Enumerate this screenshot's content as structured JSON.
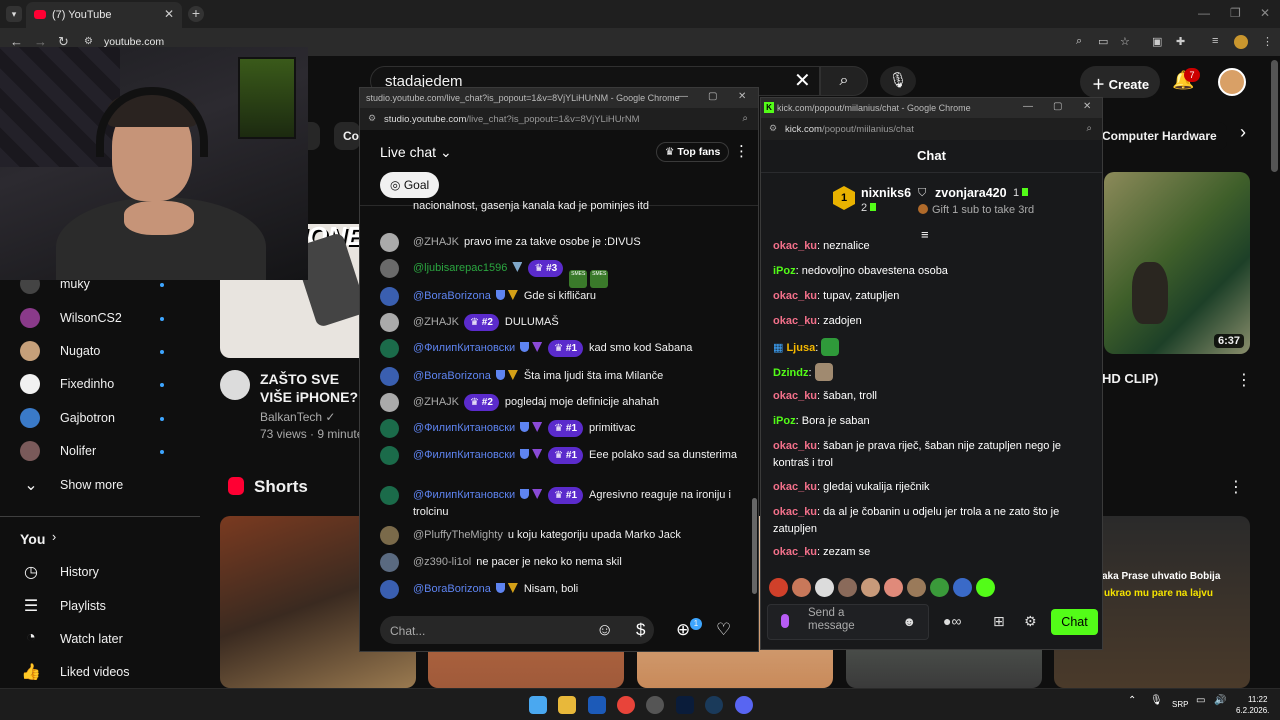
{
  "browser": {
    "tab_title": "(7) YouTube",
    "url": "youtube.com"
  },
  "youtube": {
    "search_query": "stadajedem",
    "create_label": "Create",
    "notif_count": "7",
    "chips": [
      "g",
      "Co",
      "Computer Hardware"
    ],
    "sidebar": [
      {
        "label": "muky",
        "color": "#444444"
      },
      {
        "label": "WilsonCS2",
        "color": "#8a3a8a"
      },
      {
        "label": "Nugato",
        "color": "#c6a07a"
      },
      {
        "label": "Fixedinho",
        "color": "#f1f1f1"
      },
      {
        "label": "Gajbotron",
        "color": "#3a7ac8"
      },
      {
        "label": "Nolifer",
        "color": "#7a5a5a"
      }
    ],
    "show_more": "Show more",
    "you_label": "You",
    "you_items": [
      "History",
      "Playlists",
      "Watch later",
      "Liked videos"
    ],
    "video": {
      "title": "ZAŠTO SVE VIŠE iPHONE?",
      "thumb_text": "ID TE E LIC IONE",
      "channel": "BalkanTech",
      "meta": "73 views · 9 minute"
    },
    "right_video": {
      "title_fragment": "HD CLIP)",
      "duration": "6:37"
    },
    "shorts_label": "Shorts",
    "short_caption_1": "aka Prase uhvatio Bobija",
    "short_caption_2": "ukrao mu pare na lajvu"
  },
  "yt_chat": {
    "window_title": "studio.youtube.com/live_chat?is_popout=1&v=8VjYLiHUrNM - Google Chrome",
    "url_host": "studio.youtube.com",
    "url_path": "/live_chat?is_popout=1&v=8VjYLiHUrNM",
    "header": "Live chat",
    "top_fans": "Top fans",
    "goal": "Goal",
    "input_placeholder": "Chat...",
    "plus_badge": "1",
    "messages": [
      {
        "name": "",
        "text": "nacionalnost, gasenja kanala kad je pominjes itd",
        "cls": "",
        "rank": "",
        "shield": false,
        "v": "",
        "av": "#4a4a4a"
      },
      {
        "name": "@ZHAJK",
        "text": "pravo ime za takve osobe je :DIVUS",
        "cls": "",
        "rank": "",
        "shield": false,
        "v": "",
        "av": "#aaaaaa"
      },
      {
        "name": "@ljubisarepac1596",
        "text": "",
        "cls": "green",
        "rank": "#3",
        "shield": false,
        "v": "#7fa7c8",
        "av": "#6a6a6a",
        "emotes": true
      },
      {
        "name": "@BoraBorizona",
        "text": "Gde si kifličaru",
        "cls": "mem",
        "rank": "",
        "shield": true,
        "v": "#d4a017",
        "av": "#3a5fb0"
      },
      {
        "name": "@ZHAJK",
        "text": "DULUMAŠ",
        "cls": "",
        "rank": "#2",
        "shield": false,
        "v": "",
        "av": "#aaaaaa"
      },
      {
        "name": "@ФилипКитановски",
        "text": "kad smo kod Sabana",
        "cls": "mem",
        "rank": "#1",
        "shield": true,
        "v": "#8a4ad6",
        "av": "#1b6b4a"
      },
      {
        "name": "@BoraBorizona",
        "text": "Šta ima ljudi šta ima Milanče",
        "cls": "mem",
        "rank": "",
        "shield": true,
        "v": "#d4a017",
        "av": "#3a5fb0"
      },
      {
        "name": "@ZHAJK",
        "text": "pogledaj moje definicije ahahah",
        "cls": "",
        "rank": "#2",
        "shield": false,
        "v": "",
        "av": "#aaaaaa"
      },
      {
        "name": "@ФилипКитановски",
        "text": "primitivac",
        "cls": "mem",
        "rank": "#1",
        "shield": true,
        "v": "#8a4ad6",
        "av": "#1b6b4a"
      },
      {
        "name": "@ФилипКитановски",
        "text": "Eee polako sad sa dunsterima",
        "cls": "mem",
        "rank": "#1",
        "shield": true,
        "v": "#8a4ad6",
        "av": "#1b6b4a"
      },
      {
        "name": "@ФилипКитановски",
        "text": "Agresivno reaguje na ironiju i trolcinu",
        "cls": "mem",
        "rank": "#1",
        "shield": true,
        "v": "#8a4ad6",
        "av": "#1b6b4a"
      },
      {
        "name": "@PluffyTheMighty",
        "text": "u koju kategoriju upada Marko Jack",
        "cls": "",
        "rank": "",
        "shield": false,
        "v": "",
        "av": "#7a6a4a"
      },
      {
        "name": "@z390-li1ol",
        "text": "ne pacer je neko ko nema skil",
        "cls": "",
        "rank": "",
        "shield": false,
        "v": "",
        "av": "#5a6a80"
      },
      {
        "name": "@BoraBorizona",
        "text": "Nisam, boli",
        "cls": "mem",
        "rank": "",
        "shield": true,
        "v": "#d4a017",
        "av": "#3a5fb0"
      }
    ],
    "emote_1": "SMES",
    "emote_2": "SMES"
  },
  "kick_chat": {
    "window_title": "kick.com/popout/miilanius/chat - Google Chrome",
    "url_host": "kick.com",
    "url_path": "/popout/miilanius/chat",
    "header": "Chat",
    "top1_rank": "1",
    "top1_name": "nixniks6",
    "top1_count": "2",
    "top2_name": "zvonjara420",
    "top2_count": "1",
    "gift_text": "Gift 1 sub to take 3rd",
    "messages": [
      {
        "name": "okac_ku",
        "text": "neznalice",
        "color": "#f2708a"
      },
      {
        "name": "iPoz",
        "text": "nedovoljno obavestena osoba",
        "color": "#53fc18"
      },
      {
        "name": "okac_ku",
        "text": "tupav, zatupljen",
        "color": "#f2708a"
      },
      {
        "name": "okac_ku",
        "text": "zadojen",
        "color": "#f2708a"
      },
      {
        "name": "Ljusa",
        "text": "",
        "color": "#f5b800",
        "emote": "#2f9a3a"
      },
      {
        "name": "Dzindz",
        "text": "",
        "color": "#53fc18",
        "emote": "#a08a70"
      },
      {
        "name": "okac_ku",
        "text": "šaban, troll",
        "color": "#f2708a"
      },
      {
        "name": "iPoz",
        "text": "Bora je saban",
        "color": "#53fc18"
      },
      {
        "name": "okac_ku",
        "text": "šaban je prava riječ, šaban nije zatupljen nego je kontraš i trol",
        "color": "#f2708a"
      },
      {
        "name": "okac_ku",
        "text": "gledaj vukalija riječnik",
        "color": "#f2708a"
      },
      {
        "name": "okac_ku",
        "text": "da al je čobanin u odjelu jer trola a ne zato što je zatupljen",
        "color": "#f2708a"
      },
      {
        "name": "okac_ku",
        "text": "zezam se",
        "color": "#f2708a"
      }
    ],
    "input_placeholder": "Send a message",
    "send_label": "Chat"
  },
  "taskbar": {
    "lang": "SRP",
    "time": "11:22",
    "date": "6.2.2026."
  }
}
